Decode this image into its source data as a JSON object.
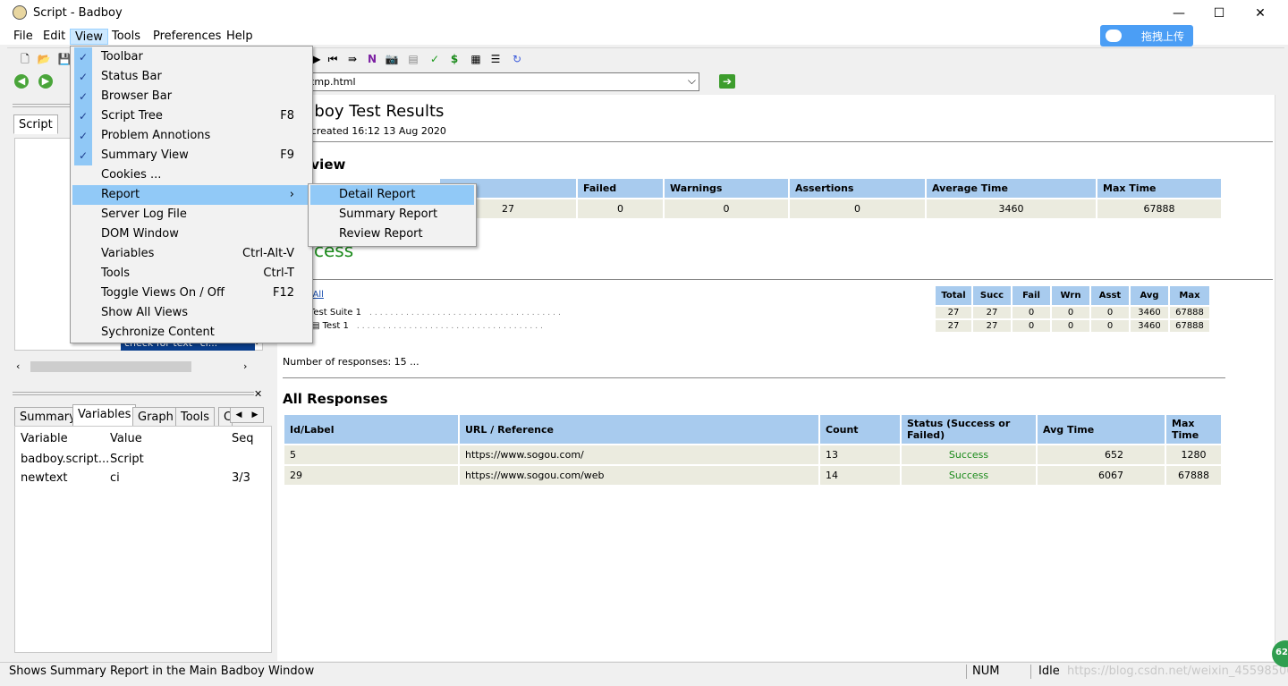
{
  "window": {
    "title": "Script - Badboy",
    "minimize": "—",
    "maximize": "☐",
    "close": "✕"
  },
  "menubar": [
    "File",
    "Edit",
    "View",
    "Tools",
    "Preferences",
    "Help"
  ],
  "upload_button": "拖拽上传",
  "address": {
    "url": "tmp.html"
  },
  "left_tabs": {
    "script": "Script"
  },
  "bottom_tabs": [
    "Summary",
    "Variables",
    "Graph",
    "Tools",
    "C"
  ],
  "variables": {
    "headers": [
      "Variable",
      "Value",
      "Seq"
    ],
    "rows": [
      [
        "badboy.script...",
        "Script",
        ""
      ],
      [
        "newtext",
        "ci",
        "3/3"
      ]
    ]
  },
  "tree_fragment": "check for text \"ci...\"",
  "view_menu": [
    {
      "label": "Toolbar",
      "checked": true,
      "shortcut": ""
    },
    {
      "label": "Status Bar",
      "checked": true,
      "shortcut": ""
    },
    {
      "label": "Browser Bar",
      "checked": true,
      "shortcut": ""
    },
    {
      "label": "Script Tree",
      "checked": true,
      "shortcut": "F8"
    },
    {
      "label": "Problem Annotions",
      "checked": true,
      "shortcut": ""
    },
    {
      "label": "Summary View",
      "checked": true,
      "shortcut": "F9"
    },
    {
      "label": "Cookies ...",
      "checked": false,
      "shortcut": ""
    },
    {
      "label": "Report",
      "checked": false,
      "shortcut": "›"
    },
    {
      "label": "Server Log File",
      "checked": false,
      "shortcut": ""
    },
    {
      "label": "DOM Window",
      "checked": false,
      "shortcut": ""
    },
    {
      "label": "Variables",
      "checked": false,
      "shortcut": "Ctrl-Alt-V"
    },
    {
      "label": "Tools",
      "checked": false,
      "shortcut": "Ctrl-T"
    },
    {
      "label": "Toggle Views On / Off",
      "checked": false,
      "shortcut": "F12"
    },
    {
      "label": "Show All Views",
      "checked": false,
      "shortcut": ""
    },
    {
      "label": "Sychronize Content",
      "checked": false,
      "shortcut": ""
    }
  ],
  "report_submenu": [
    "Detail Report",
    "Summary Report",
    "Review Report"
  ],
  "report": {
    "title": "dboy Test Results",
    "created": "t created 16:12 13 Aug 2020",
    "overview_heading": "rview",
    "overview": {
      "headers": [
        "eded",
        "Failed",
        "Warnings",
        "Assertions",
        "Average Time",
        "Max Time"
      ],
      "values": [
        "27",
        "0",
        "0",
        "0",
        "3460",
        "67888"
      ]
    },
    "result": "ccess",
    "expand_all": "d All",
    "suites": [
      {
        "name": "Test Suite 1"
      },
      {
        "name": "Test 1"
      }
    ],
    "stats": {
      "headers": [
        "Total",
        "Succ",
        "Fail",
        "Wrn",
        "Asst",
        "Avg",
        "Max"
      ],
      "rows": [
        [
          "27",
          "27",
          "0",
          "0",
          "0",
          "3460",
          "67888"
        ],
        [
          "27",
          "27",
          "0",
          "0",
          "0",
          "3460",
          "67888"
        ]
      ]
    },
    "num_responses": "Number of responses: 15 ...",
    "all_responses_heading": "All Responses",
    "responses": {
      "headers": [
        "Id/Label",
        "URL / Reference",
        "Count",
        "Status (Success or Failed)",
        "Avg Time",
        "Max Time"
      ],
      "rows": [
        [
          "5",
          "https://www.sogou.com/",
          "13",
          "Success",
          "652",
          "1280"
        ],
        [
          "29",
          "https://www.sogou.com/web",
          "14",
          "Success",
          "6067",
          "67888"
        ]
      ]
    }
  },
  "statusbar": {
    "message": "Shows Summary Report in the Main Badboy Window",
    "num": "NUM",
    "state": "Idle",
    "watermark": "https://blog.csdn.net/weixin_45598506"
  },
  "badge": "62"
}
